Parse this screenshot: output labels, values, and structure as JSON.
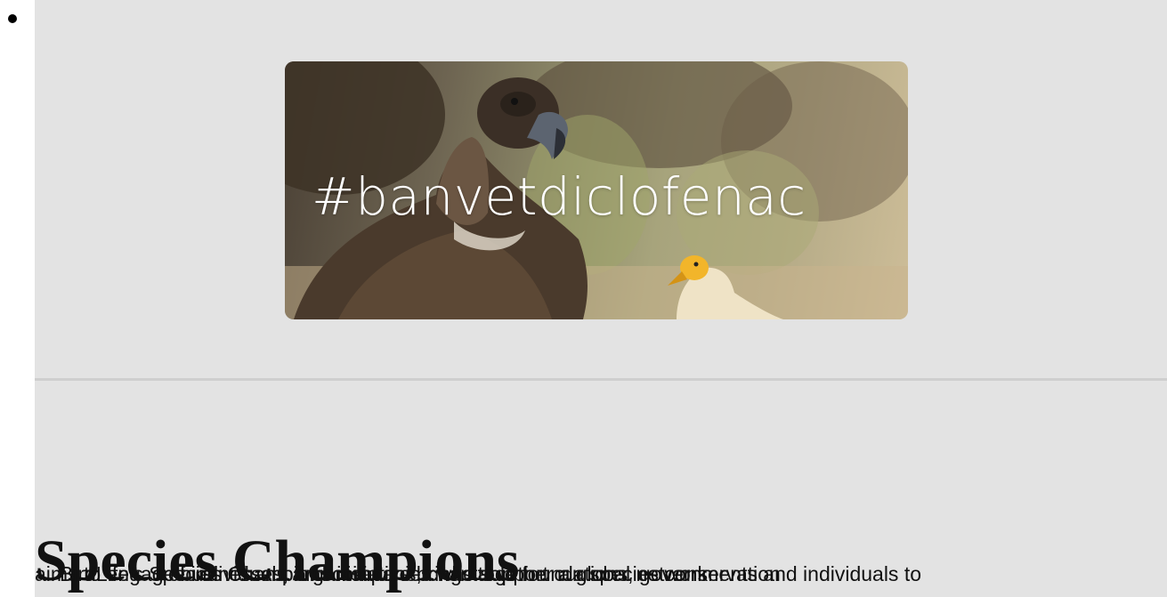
{
  "list": {
    "bullet": "•"
  },
  "banner": {
    "hashtag": "#banvetdiclofenac"
  },
  "section": {
    "heading": "Species Champions",
    "overlapping_lines": [
      "aims to engage businesses, organisations, charitable foundations, governments and individuals to",
      "BirdLife's Species Champions initiative brings together a global network",
      "of individuals and companies who support our species conservation"
    ],
    "trailing_word": "conservation"
  }
}
